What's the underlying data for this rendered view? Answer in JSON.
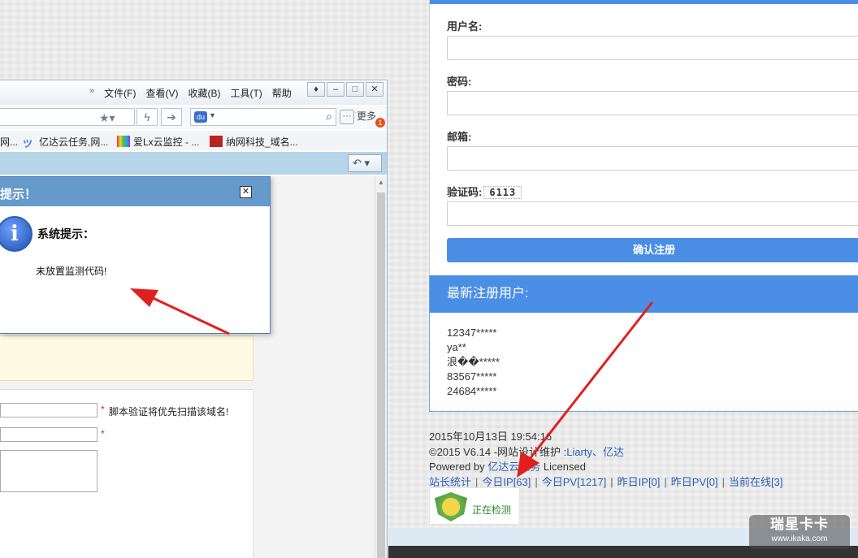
{
  "browser": {
    "menu_chevron": "»",
    "menu": [
      "文件(F)",
      "查看(V)",
      "收藏(B)",
      "工具(T)",
      "帮助"
    ],
    "more_label": "更多",
    "more_badge": "1",
    "favorites": [
      {
        "label": "网...",
        "color": "#c33"
      },
      {
        "label": "亿达云任务,网...",
        "color": "#2a78d6"
      },
      {
        "label": "爱Lx云监控 - ...",
        "color": "#e84"
      },
      {
        "label": "纳网科技_域名...",
        "color": "#b22"
      }
    ]
  },
  "dialog": {
    "title": "提示！",
    "heading": "系统提示：",
    "message": "未放置监测代码!",
    "close_glyph": "✕"
  },
  "page_form": {
    "note": "脚本验证将优先扫描该域名!",
    "required_mark": "*"
  },
  "register": {
    "username_label": "用户名:",
    "password_label": "密码:",
    "email_label": "邮箱:",
    "captcha_label": "验证码:",
    "captcha_value": "6113",
    "submit_label": "确认注册"
  },
  "latest_users": {
    "title": "最新注册用户:",
    "users": [
      "12347*****",
      "ya**",
      "浪��*****",
      "83567*****",
      "24684*****"
    ]
  },
  "footer": {
    "datetime": "2015年10月13日 19:54:16",
    "copyright_prefix": "©2015 V6.14 -网站设计维护 :",
    "copyright_link": "Liarty、亿达",
    "powered_prefix": "Powered by ",
    "powered_link": "亿达云任务",
    "powered_suffix": " Licensed",
    "stats": [
      "站长统计",
      "今日IP[63]",
      "今日PV[1217]",
      "昨日IP[0]",
      "昨日PV[0]",
      "当前在线[3]"
    ],
    "stats_separator": "|",
    "checking_label": "正在检测"
  },
  "watermark": {
    "brand": "瑞星卡卡",
    "url": "www.ikaka.com"
  },
  "colors": {
    "accent_blue": "#4a8ee6",
    "dialog_header": "#6699cc",
    "arrow_red": "#e02020"
  }
}
